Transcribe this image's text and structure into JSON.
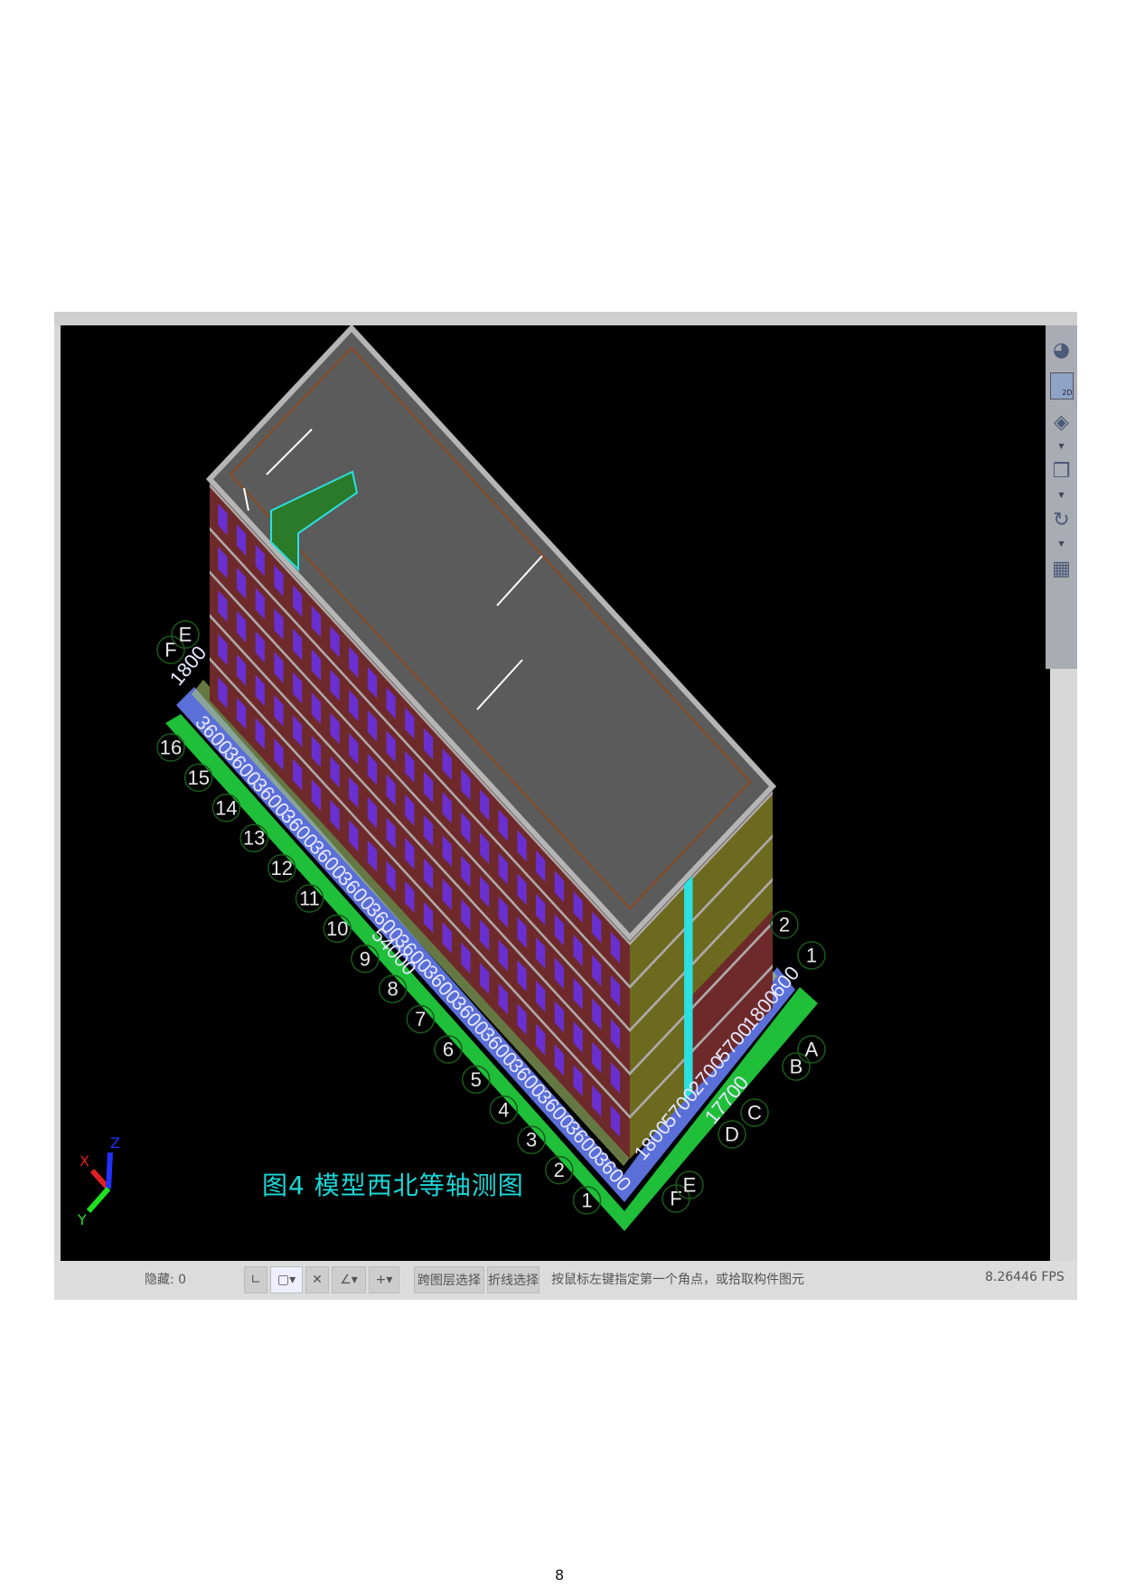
{
  "caption": "图4   模型西北等轴测图",
  "page_number": "8",
  "viewport": {
    "grid_axes_left": [
      "16",
      "15",
      "14",
      "13",
      "12",
      "11",
      "10",
      "9",
      "8",
      "7",
      "6",
      "5",
      "4",
      "3",
      "2",
      "1"
    ],
    "grid_axes_letters_left": [
      "F",
      "E"
    ],
    "grid_axes_letters_bottom": [
      "F",
      "E",
      "D",
      "C",
      "B",
      "A"
    ],
    "grid_axes_right": [
      "2",
      "1"
    ],
    "dims_long": [
      "1800",
      "3600",
      "3600",
      "3600",
      "3600",
      "3600",
      "3600",
      "3600",
      "3600",
      "3600",
      "3600",
      "3600",
      "3600",
      "3600",
      "3600",
      "3600"
    ],
    "dim_long_total": "54000",
    "dims_short": [
      "1800",
      "5700",
      "2700",
      "5700",
      "1800",
      "600"
    ],
    "dim_short_total": "17700",
    "axis_labels": {
      "x": "X",
      "y": "Y",
      "z": "Z"
    },
    "colors": {
      "roof": "#5b5b5b",
      "wall": "#6e2a2a",
      "side_wall": "#6b6a1e",
      "window": "#6a2fd0",
      "base_green": "#1fbf3a",
      "base_blue": "#5a6fd8",
      "caption": "#1ed6d6"
    }
  },
  "toolbar": {
    "icons": [
      "orbit-icon",
      "2d-view-icon",
      "navigation-cube-icon",
      "box-view-icon",
      "rotate-icon",
      "layout-icon"
    ],
    "view_2d_label": "2D"
  },
  "statusbar": {
    "hidden_count": "隐藏: 0",
    "cross_layer_select": "跨图层选择",
    "polyline_select": "折线选择",
    "prompt": "按鼠标左键指定第一个角点，或拾取构件图元",
    "fps": "8.26446 FPS"
  }
}
